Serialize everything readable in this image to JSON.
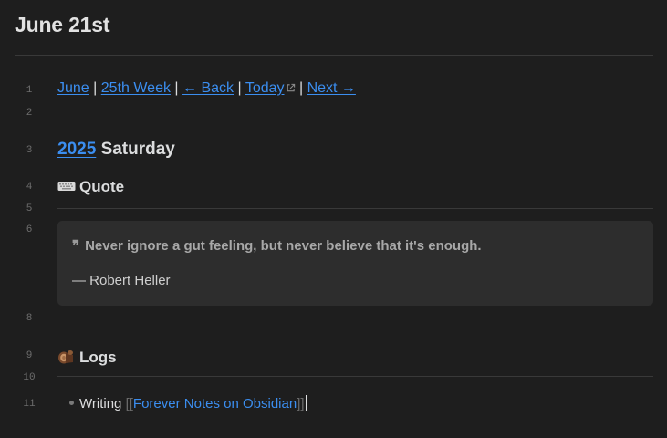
{
  "note": {
    "title": "June 21st"
  },
  "nav": {
    "month": "June",
    "week": "25th Week",
    "back": "← Back",
    "today": "Today",
    "next": "Next →",
    "separator": "|"
  },
  "heading": {
    "year": "2025",
    "day": "Saturday"
  },
  "quote_section": {
    "icon": "keyboard-icon",
    "label": "Quote",
    "text": "Never ignore a gut feeling, but never believe that it's enough.",
    "author": "— Robert Heller",
    "mark": "❞"
  },
  "logs_section": {
    "icon": "log-wood-icon",
    "label": "Logs"
  },
  "log_item": {
    "text": "Writing",
    "open_brackets": "[[",
    "link": "Forever Notes on Obsidian",
    "close_brackets": "]]"
  },
  "line_numbers": [
    "1",
    "2",
    "3",
    "4",
    "5",
    "6",
    "8",
    "9",
    "10",
    "11"
  ],
  "colors": {
    "background": "#1e1e1e",
    "accent_link": "#3b8ef0",
    "callout_bg": "#2d2d2d"
  }
}
